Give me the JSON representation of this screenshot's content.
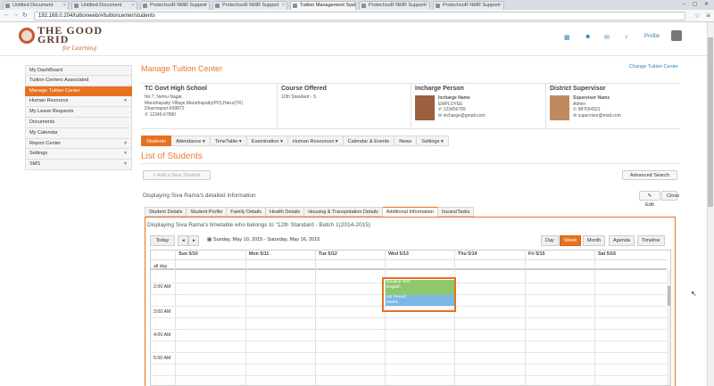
{
  "browser": {
    "tabs": [
      {
        "label": "Untitled Document"
      },
      {
        "label": "Untitled Document"
      },
      {
        "label": "ProtechsoR NMR Support"
      },
      {
        "label": "ProtechsoR NMR Support"
      },
      {
        "label": "Tuition Management Syst"
      },
      {
        "label": "ProtechsoR NMR Support"
      },
      {
        "label": "ProtechsoR NMR Support"
      }
    ],
    "url": "192.168.0.204/tuitionweb/#/tuitioncenter/students"
  },
  "header": {
    "logo_line1": "THE GOOD",
    "logo_line2": "GRID",
    "logo_sub": "for Learning",
    "icons": [
      "grid-icon",
      "users-icon",
      "mail-icon",
      "bell-icon"
    ],
    "profile_label": "Profile"
  },
  "sidebar": {
    "items": [
      {
        "label": "My DashBoard"
      },
      {
        "label": "Tuition Centers Associated"
      },
      {
        "label": "Manage Tuition Center"
      },
      {
        "label": "Human Resource"
      },
      {
        "label": "My Leave Requests"
      },
      {
        "label": "Documents"
      },
      {
        "label": "My Calendar"
      },
      {
        "label": "Report Center"
      },
      {
        "label": "Settings"
      },
      {
        "label": "SMS"
      }
    ]
  },
  "page": {
    "title": "Manage Tuition Center",
    "change_link": "Change Tuition Center"
  },
  "info": {
    "center": {
      "name": "TC Govt High School",
      "address1": "No:7, Nehru Nagar,",
      "address2": "Maruthapatty Village,Maruthapatty(PO),Harur(TK)",
      "address3": "Dharmapuri-609872",
      "phone": "12345-67890"
    },
    "course": {
      "heading": "Course Offered",
      "value": "12th Standard - S"
    },
    "incharge": {
      "heading": "Incharge Person",
      "name": "Incharge Name",
      "role": "EMPLOYEE",
      "phone": "123456789",
      "email": "incharge@gmail.com"
    },
    "supervisor": {
      "heading": "District Supervisor",
      "name": "Supervisor Name",
      "role": "Admin",
      "phone": "987654321",
      "email": "supervisor@mail.com"
    }
  },
  "menu_tabs": [
    {
      "label": "Students"
    },
    {
      "label": "Attendance ▾"
    },
    {
      "label": "TimeTable ▾"
    },
    {
      "label": "Examination ▾"
    },
    {
      "label": "Human Resources ▾"
    },
    {
      "label": "Calendar & Events"
    },
    {
      "label": "News"
    },
    {
      "label": "Settings ▾"
    }
  ],
  "list": {
    "title": "List of Students",
    "add_button": "+ Add a New Student",
    "advanced_search": "Advanced Search",
    "display_text": "Displaying Siva Rama's detailed information",
    "edit_button": "✎ Edit",
    "close_button": "Close"
  },
  "detail_tabs": [
    {
      "label": "Student Details"
    },
    {
      "label": "Student Profile"
    },
    {
      "label": "Family Details"
    },
    {
      "label": "Health Details"
    },
    {
      "label": "Housing & Transpotation Details"
    },
    {
      "label": "Additional Information"
    },
    {
      "label": "Issues/Tasks"
    }
  ],
  "timetable": {
    "title": "Displaying Siva Rama's timetable who belongs to \"12th Standard - Batch 1(2014-2015)",
    "today": "Today",
    "date_range": "Sunday, May 10, 2015 - Saturday, May 16, 2015",
    "views": [
      {
        "label": "Day"
      },
      {
        "label": "Week"
      },
      {
        "label": "Month"
      },
      {
        "label": "Agenda"
      },
      {
        "label": "Timeline"
      }
    ],
    "active_view": "Week",
    "days": [
      "Sun 5/10",
      "Mon 5/11",
      "Tue 5/12",
      "Wed 5/13",
      "Thu 5/14",
      "Fri 5/15",
      "Sat 5/16"
    ],
    "allday_label": "all day",
    "times": [
      "2:00 AM",
      "3:00 AM",
      "4:00 AM",
      "5:00 AM"
    ],
    "events": [
      {
        "title": "Routine Test",
        "subject": "English",
        "color": "#8dc96b"
      },
      {
        "title": "1st Period",
        "subject": "Maths",
        "color": "#7ab8e8"
      }
    ]
  }
}
